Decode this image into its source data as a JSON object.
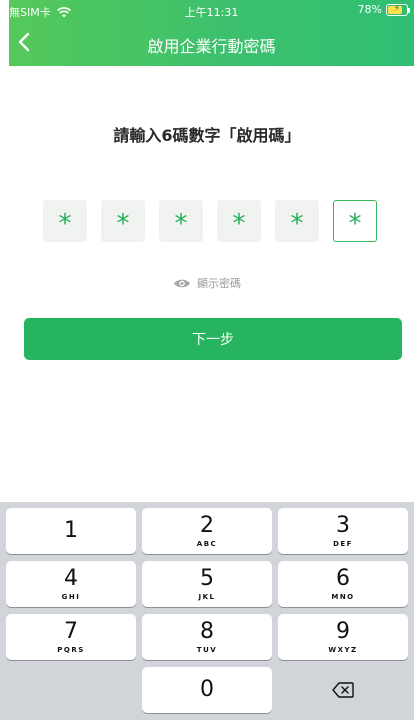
{
  "status_bar": {
    "carrier": "無SIM卡",
    "time": "上午11:31",
    "battery": "78%",
    "battery_level": 0.78
  },
  "nav": {
    "title": "啟用企業行動密碼",
    "back_icon": "chevron-left-icon"
  },
  "main": {
    "prompt": "請輸入6碼數字「啟用碼」",
    "pin": [
      "*",
      "*",
      "*",
      "*",
      "*",
      "*"
    ],
    "active_index": 5,
    "show_password_label": "顯示密碼",
    "next_label": "下一步"
  },
  "keypad": {
    "keys": [
      {
        "num": "1",
        "letters": ""
      },
      {
        "num": "2",
        "letters": "ABC"
      },
      {
        "num": "3",
        "letters": "DEF"
      },
      {
        "num": "4",
        "letters": "GHI"
      },
      {
        "num": "5",
        "letters": "JKL"
      },
      {
        "num": "6",
        "letters": "MNO"
      },
      {
        "num": "7",
        "letters": "PQRS"
      },
      {
        "num": "8",
        "letters": "TUV"
      },
      {
        "num": "9",
        "letters": "WXYZ"
      },
      {
        "num": "0",
        "letters": ""
      }
    ],
    "delete_icon": "backspace-icon"
  },
  "colors": {
    "accent": "#27b45e",
    "header_start": "#55c95a",
    "header_end": "#2fbf72",
    "keypad_bg": "#d1d4d9"
  }
}
